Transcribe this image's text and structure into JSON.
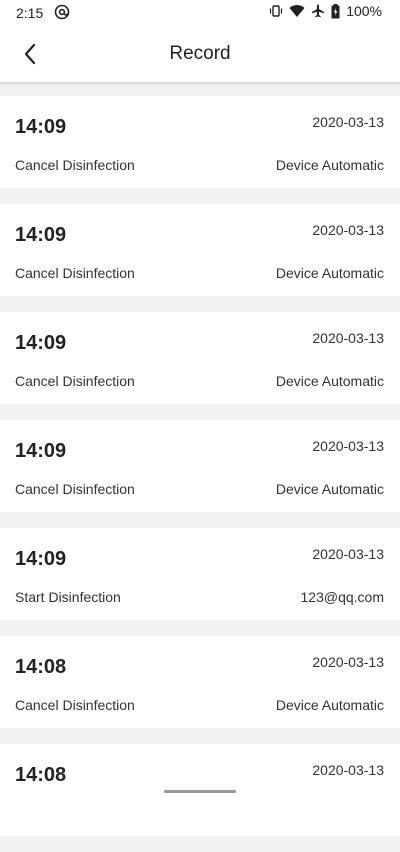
{
  "status_bar": {
    "time": "2:15",
    "battery_percent": "100%",
    "icons": [
      "at-sign-icon",
      "vibrate-icon",
      "wifi-icon",
      "airplane-icon",
      "battery-icon"
    ]
  },
  "app_bar": {
    "title": "Record",
    "back_icon": "chevron-left-icon"
  },
  "records": [
    {
      "time": "14:09",
      "date": "2020-03-13",
      "action": "Cancel Disinfection",
      "operator": "Device Automatic"
    },
    {
      "time": "14:09",
      "date": "2020-03-13",
      "action": "Cancel Disinfection",
      "operator": "Device Automatic"
    },
    {
      "time": "14:09",
      "date": "2020-03-13",
      "action": "Cancel Disinfection",
      "operator": "Device Automatic"
    },
    {
      "time": "14:09",
      "date": "2020-03-13",
      "action": "Cancel Disinfection",
      "operator": "Device Automatic"
    },
    {
      "time": "14:09",
      "date": "2020-03-13",
      "action": "Start Disinfection",
      "operator": "123@qq.com"
    },
    {
      "time": "14:08",
      "date": "2020-03-13",
      "action": "Cancel Disinfection",
      "operator": "Device Automatic"
    },
    {
      "time": "14:08",
      "date": "2020-03-13",
      "action": "",
      "operator": ""
    }
  ]
}
